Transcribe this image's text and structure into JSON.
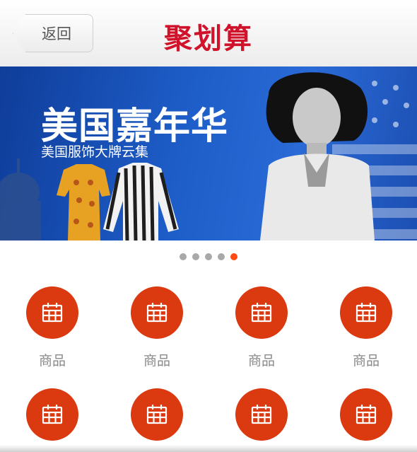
{
  "header": {
    "back_label": "返回",
    "brand_title": "聚划算"
  },
  "banner": {
    "title": "美国嘉年华",
    "subtitle": "美国服饰大牌云集",
    "dots_total": 5,
    "active_dot": 5
  },
  "grid": {
    "items": [
      {
        "label": "商品",
        "icon": "calendar-icon"
      },
      {
        "label": "商品",
        "icon": "calendar-icon"
      },
      {
        "label": "商品",
        "icon": "calendar-icon"
      },
      {
        "label": "商品",
        "icon": "calendar-icon"
      },
      {
        "label": "",
        "icon": "calendar-icon"
      },
      {
        "label": "",
        "icon": "calendar-icon"
      },
      {
        "label": "",
        "icon": "calendar-icon"
      },
      {
        "label": "",
        "icon": "calendar-icon"
      }
    ]
  },
  "colors": {
    "brand_red": "#d0122b",
    "icon_circle": "#db3a10",
    "active_dot": "#ff4a14",
    "banner_blue": "#1e5ec9"
  }
}
